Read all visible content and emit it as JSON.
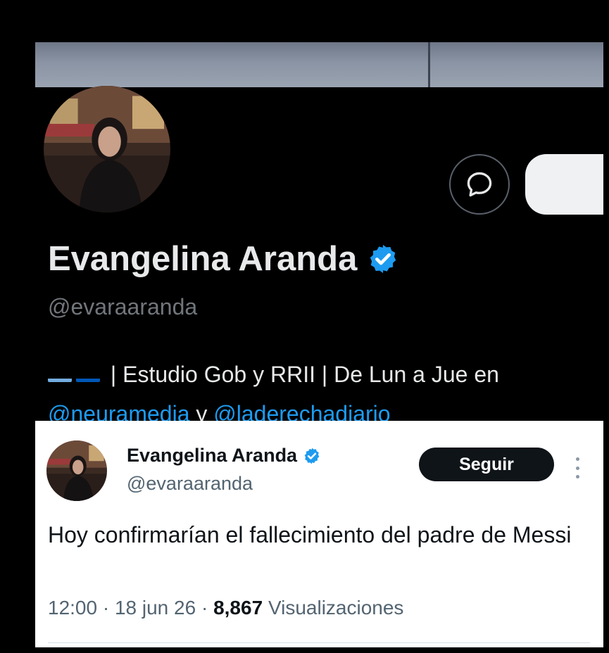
{
  "profile": {
    "name": "Evangelina Aranda",
    "handle": "@evaraaranda",
    "bio": {
      "flags": [
        "argentina-flag",
        "ukraine-flag"
      ],
      "text": " | Estudio Gob y RRII | De Lun a Jue en",
      "mention1": "@neuramedia",
      "connector": " y ",
      "mention2": "@laderechadiario"
    },
    "icons": [
      "message-icon",
      "verified-badge-icon"
    ]
  },
  "tweet": {
    "author_name": "Evangelina Aranda",
    "author_handle": "@evaraaranda",
    "follow_label": "Seguir",
    "text": "Hoy confirmarían el fallecimiento del padre de Messi",
    "time": "12:00",
    "separator1": " · ",
    "date": "18 jun 26",
    "separator2": " · ",
    "views_count": "8,867",
    "views_label": "Visualizaciones"
  },
  "colors": {
    "verified": "#1d9bf0",
    "link": "#1d9bf0",
    "background": "#000000",
    "tweet_card": "#ffffff"
  }
}
